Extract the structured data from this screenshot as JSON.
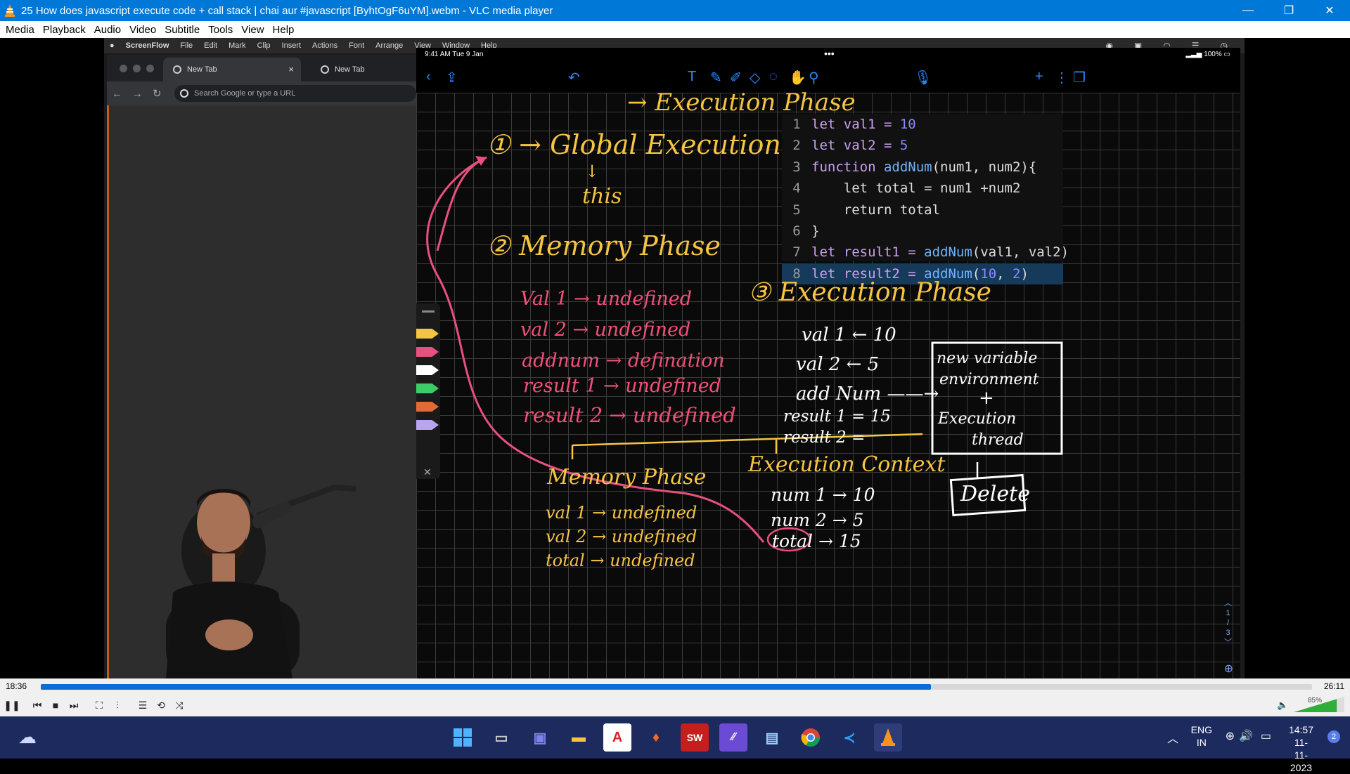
{
  "window": {
    "title": "25 How does javascript execute code + call stack  |  chai aur #javascript [ByhtOgF6uYM].webm - VLC media player",
    "minimize": "—",
    "maximize": "❐",
    "close": "✕"
  },
  "menu": [
    "Media",
    "Playback",
    "Audio",
    "Video",
    "Subtitle",
    "Tools",
    "View",
    "Help"
  ],
  "mac_menubar": {
    "apple": "",
    "items": [
      "ScreenFlow",
      "File",
      "Edit",
      "Mark",
      "Clip",
      "Insert",
      "Actions",
      "Font",
      "Arrange",
      "View",
      "Window",
      "Help"
    ]
  },
  "chrome": {
    "tab1": "New Tab",
    "tab2": "New Tab",
    "tab_close": "×",
    "omnibox_placeholder": "Search Google or type a URL"
  },
  "ipad": {
    "time": "9:41 AM  Tue 9 Jan",
    "battery": "100%",
    "dots": "•••"
  },
  "code": {
    "lines": [
      {
        "n": "1"
      },
      {
        "n": "2"
      },
      {
        "n": "3"
      },
      {
        "n": "4"
      },
      {
        "n": "5"
      },
      {
        "n": "6"
      },
      {
        "n": "7"
      },
      {
        "n": "8"
      }
    ],
    "l1": [
      "let val1 = ",
      "10"
    ],
    "l2": [
      "let val2 = ",
      "5"
    ],
    "l3": [
      "function ",
      "addNum",
      "(num1, num2){"
    ],
    "l4": "    let total = num1 +num2",
    "l5": "    return total",
    "l6": "}",
    "l7": [
      "let result1 = ",
      "addNum",
      "(val1, val2)"
    ],
    "l8": [
      "let result2 = ",
      "addNum",
      "(",
      "10",
      ", ",
      "2",
      ")"
    ]
  },
  "notes": {
    "top_heading": "→ Execution Phase",
    "global": "① → Global Execution",
    "arrow_down": "↓",
    "this": "this",
    "memory_heading": "② Memory Phase",
    "mem1": "Val 1  → undefined",
    "mem2": "val 2  → undefined",
    "mem3": "addnum → defination",
    "mem4": "result 1 → undefined",
    "mem5": "result 2 → undefined",
    "exec_heading": "③ Execution Phase",
    "ex1": "val 1 ← 10",
    "ex2": "val 2 ← 5",
    "ex3": "add Num ——→",
    "ex4": "result 1 = 15",
    "ex5": "result 2 =",
    "box_line1": "new variable",
    "box_line2": "environment",
    "box_plus": "+",
    "box_line3": "Execution",
    "box_line4": "thread",
    "delete": "Delete",
    "mem2_heading": "Memory Phase",
    "m2a": "val 1  → undefined",
    "m2b": "val 2  → undefined",
    "m2c": "total  → undefined",
    "ctx_heading": "Execution Context",
    "c1": "num 1 → 10",
    "c2": "num 2 → 5",
    "c3": "total → 15"
  },
  "pages": [
    "1",
    "/",
    "3"
  ],
  "player": {
    "elapsed": "18:36",
    "total": "26:11",
    "progress_fraction": 0.7,
    "volume": "85%",
    "volume_fraction": 0.85
  },
  "taskbar": {
    "icons": [
      "windows-start",
      "file-explorer",
      "teams",
      "folder",
      "acrobat",
      "brave",
      "sw-2022",
      "visual-studio",
      "notepad",
      "chrome",
      "vscode",
      "vlc"
    ],
    "lang1": "ENG",
    "lang2": "IN",
    "time": "14:57",
    "date": "11-11-2023",
    "notif": "2"
  }
}
